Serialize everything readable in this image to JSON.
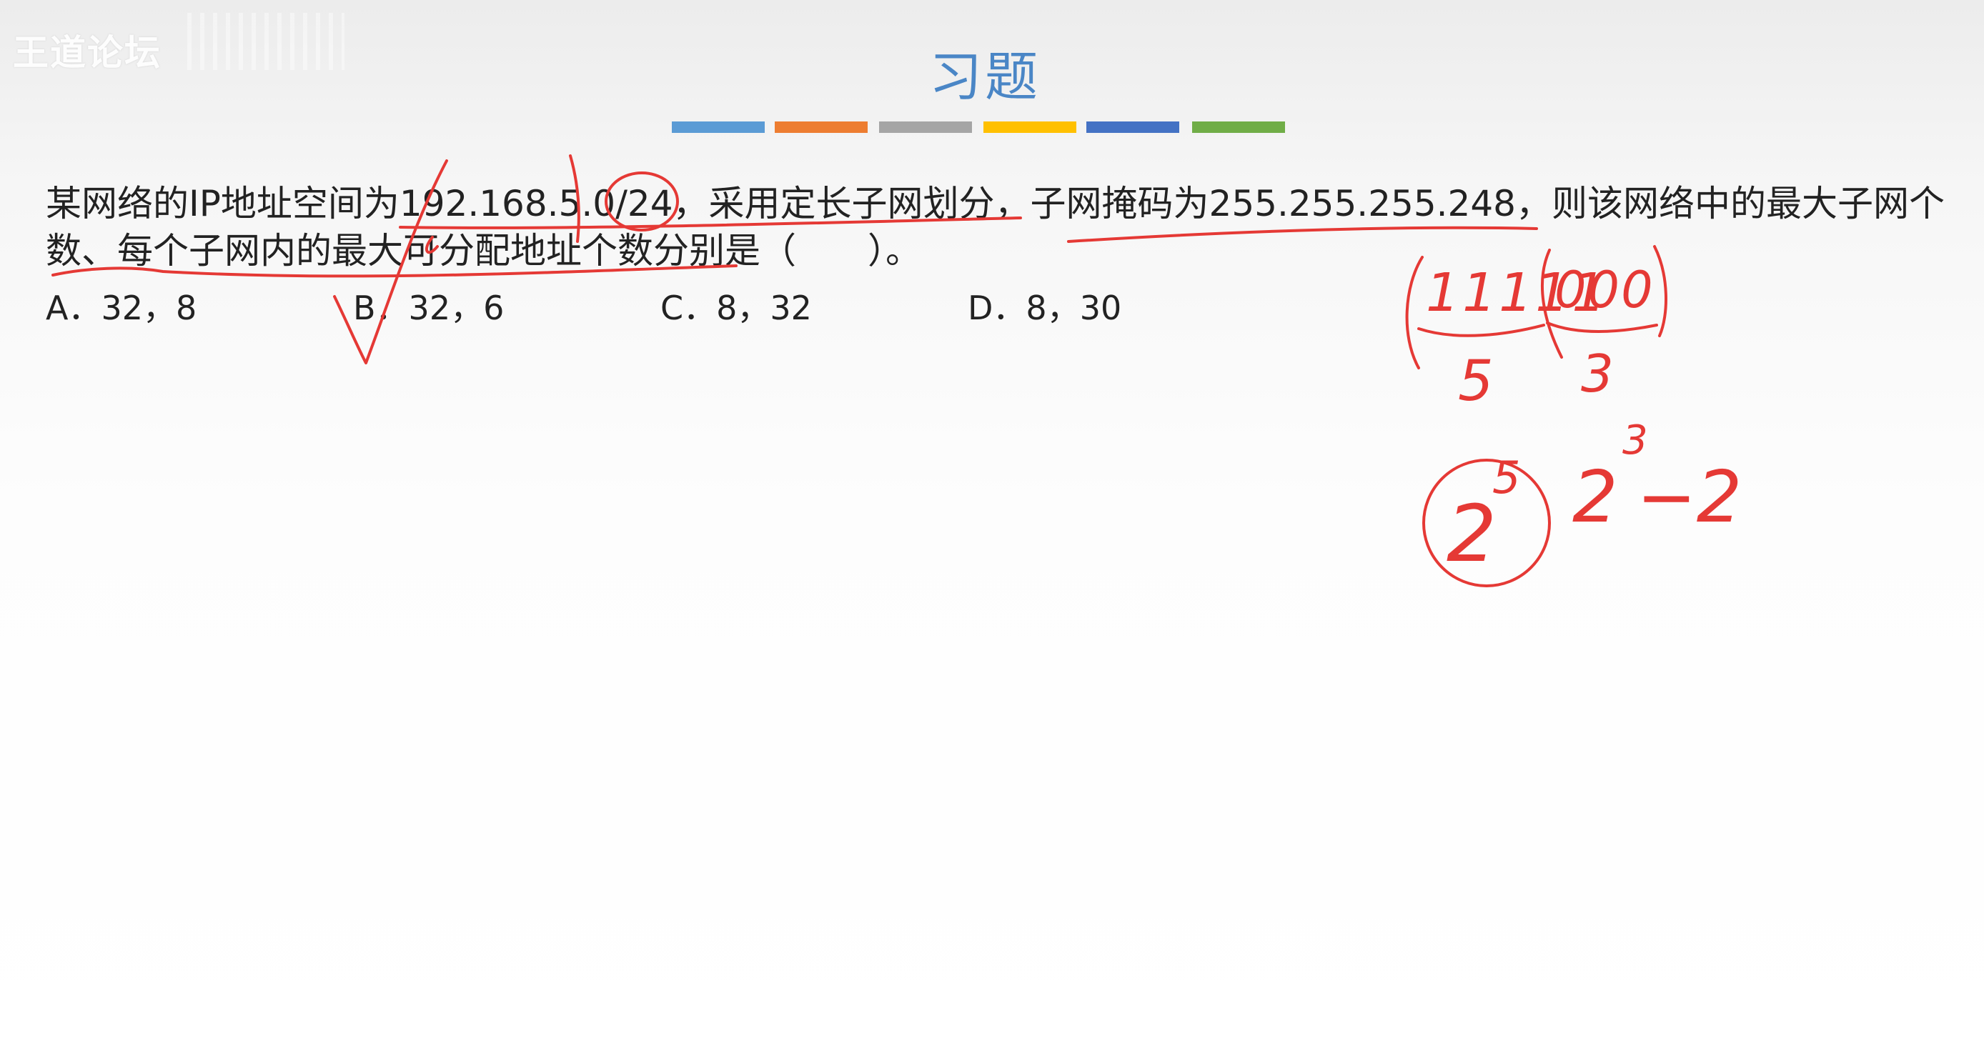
{
  "watermark": "王道论坛",
  "title": "习题",
  "color_bar": [
    "#5b9bd5",
    "#ed7d31",
    "#a5a5a5",
    "#ffc000",
    "#4472c4",
    "#70ad47"
  ],
  "question": {
    "text": "某网络的IP地址空间为192.168.5.0/24，采用定长子网划分，子网掩码为255.255.255.248，则该网络中的最大子网个数、每个子网内的最大可分配地址个数分别是（　　）。"
  },
  "options": [
    {
      "label": "A．32，8"
    },
    {
      "label": "B．32，6"
    },
    {
      "label": "C．8，32"
    },
    {
      "label": "D．8，30"
    }
  ],
  "annotations": {
    "ink_color": "#e53935",
    "binary_ones": "11111",
    "binary_zeros": "000",
    "count_ones": "5",
    "count_zeros": "3",
    "subnets_base": "2",
    "subnets_exp": "5",
    "hosts_base": "2",
    "hosts_exp": "3",
    "hosts_minus": "−2"
  }
}
